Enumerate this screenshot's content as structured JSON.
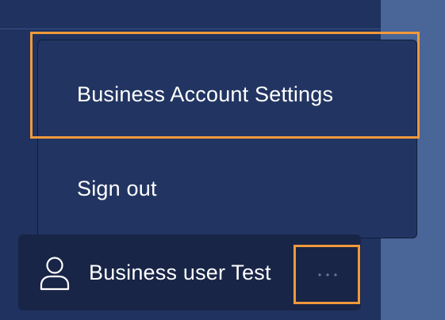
{
  "menu": {
    "items": [
      {
        "label": "Business Account Settings"
      },
      {
        "label": "Sign out"
      }
    ]
  },
  "user": {
    "name": "Business user Test",
    "icon": "user-icon",
    "more_icon": "more-horizontal-icon"
  },
  "colors": {
    "sidebar": "#20325f",
    "menu_bg": "#223562",
    "user_bar": "#182547",
    "right_panel": "#4a6597",
    "highlight": "#f0993a",
    "text": "#ffffff"
  }
}
